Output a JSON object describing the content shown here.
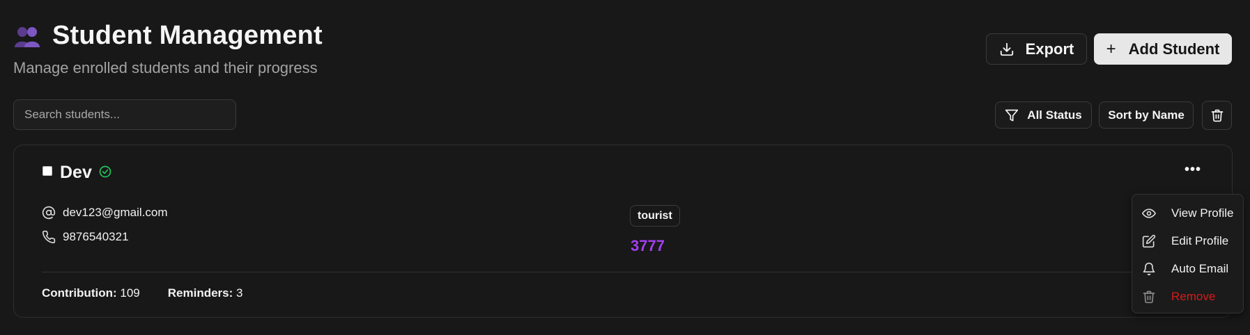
{
  "header": {
    "title": "Student Management",
    "subtitle": "Manage enrolled students and their progress",
    "title_icon": "group-icon"
  },
  "actions": {
    "export_label": "Export",
    "add_label": "Add Student"
  },
  "search": {
    "placeholder": "Search students..."
  },
  "filters": {
    "status_label": "All Status",
    "sort_label": "Sort by Name"
  },
  "student": {
    "name": "Dev",
    "verified": true,
    "email": "dev123@gmail.com",
    "phone": "9876540321",
    "tag": "tourist",
    "score": "3777",
    "contribution_label": "Contribution:",
    "contribution_value": "109",
    "reminders_label": "Reminders:",
    "reminders_value": "3"
  },
  "menu": {
    "items": [
      {
        "label": "View Profile",
        "icon": "eye-icon"
      },
      {
        "label": "Edit Profile",
        "icon": "edit-icon"
      },
      {
        "label": "Auto Email",
        "icon": "bell-icon"
      },
      {
        "label": "Remove",
        "icon": "trash-icon"
      }
    ]
  },
  "colors": {
    "accent_score": "#a33ff0",
    "danger": "#d61a1a",
    "verified": "#22c55e"
  }
}
